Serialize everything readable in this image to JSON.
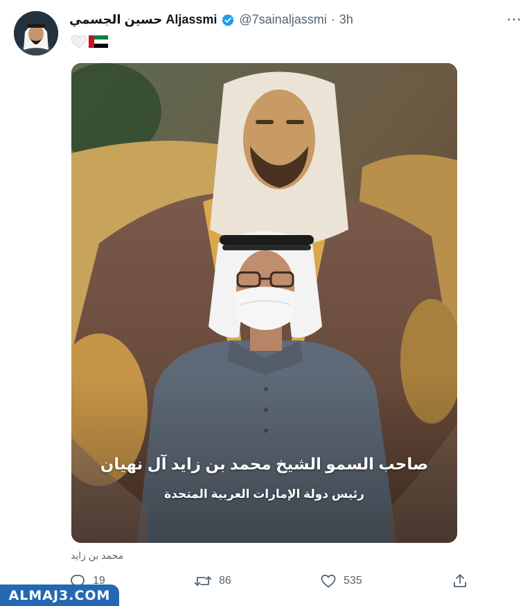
{
  "author": {
    "display_name": "حسين الجسمي Aljassmi",
    "handle": "@7sainaljassmi",
    "separator": "·",
    "time": "3h"
  },
  "tweet": {
    "caption_line1": "صاحب السمو الشيخ محمد بن زايد آل نهيان",
    "caption_line2": "رئيس دولة الإمارات العربية المتحدة",
    "image_alt": "محمد بن زايد"
  },
  "actions": {
    "reply_count": "19",
    "retweet_count": "86",
    "like_count": "535"
  },
  "icons": {
    "verified": "verified-badge-icon",
    "more": "more-options-icon",
    "heart_emoji": "white-heart-emoji",
    "flag_emoji": "uae-flag-emoji",
    "reply": "reply-icon",
    "retweet": "retweet-icon",
    "like": "like-icon",
    "share": "share-icon"
  },
  "watermark": "ALMAJ3.COM",
  "colors": {
    "verified_blue": "#1d9bf0",
    "secondary_text": "#536471",
    "watermark_blue": "#2468b4"
  }
}
